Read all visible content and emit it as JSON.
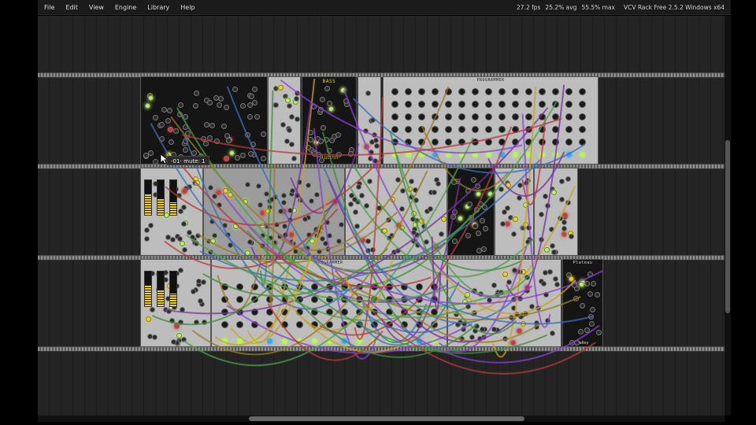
{
  "menu": {
    "items": [
      "File",
      "Edit",
      "View",
      "Engine",
      "Library",
      "Help"
    ]
  },
  "status": {
    "fps": "27.2 fps",
    "avg": "25.2% avg",
    "max": "55.5% max",
    "app_title": "VCV Rack Free 2.5.2 Windows x64"
  },
  "tooltip": {
    "text": "-01- mute: 1"
  },
  "modules": {
    "bass_label": "BASS",
    "bass_brand": "Autinn",
    "programmer_top": "PROGRAMMER",
    "programmer_bottom": "PROGRAMMER",
    "plateau_label": "Plateau",
    "valley_label": "Valley"
  },
  "colors": {
    "rack_bg": "#1e1e1e",
    "module_light": "#bdbdbd",
    "led_green": "#b7f55a",
    "led_yellow": "#f2d21b",
    "led_red": "#e03030",
    "led_blue": "#3aa8ff"
  },
  "cable_colors": [
    "#8b3fd1",
    "#c9a227",
    "#3d8f3b",
    "#b83a3a",
    "#3a6fb8",
    "#7a2fa0",
    "#9c7a20",
    "#4aa04a"
  ]
}
